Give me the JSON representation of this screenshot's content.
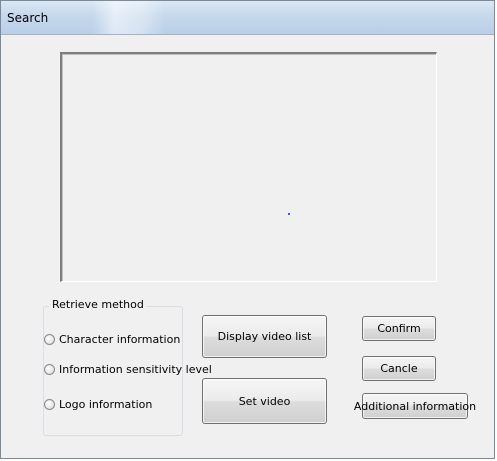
{
  "window": {
    "title": "Search"
  },
  "retrieve_method": {
    "legend": "Retrieve method",
    "options": [
      {
        "label": "Character information",
        "selected": false
      },
      {
        "label": "Information sensitivity level",
        "selected": false
      },
      {
        "label": "Logo information",
        "selected": false
      }
    ]
  },
  "buttons": {
    "display_video_list": "Display video list",
    "set_video": "Set video",
    "confirm": "Confirm",
    "cancel": "Cancle",
    "additional_information": "Additional information"
  },
  "colors": {
    "titlebar": "#c6d8ec",
    "dialog_background": "#f0f0f0",
    "button_border": "#707070"
  }
}
